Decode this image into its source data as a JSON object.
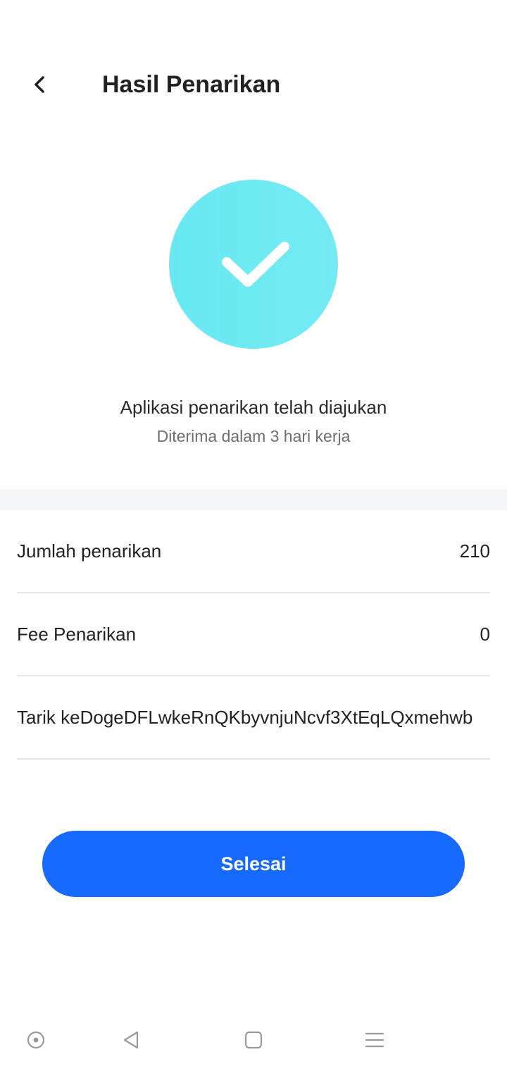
{
  "header": {
    "title": "Hasil Penarikan",
    "back_icon": "chevron-left-icon"
  },
  "status": {
    "icon": "checkmark-icon",
    "accent_color": "#6aebf2",
    "message": "Aplikasi penarikan telah diajukan",
    "submessage": "Diterima dalam 3 hari kerja"
  },
  "details": [
    {
      "label": "Jumlah penarikan",
      "value": "210"
    },
    {
      "label": "Fee Penarikan",
      "value": "0"
    },
    {
      "label": "Tarik keDogeDFLwkeRnQKbyvnjuNcvf3XtEqLQxmehwb",
      "value": ""
    }
  ],
  "actions": {
    "done_label": "Selesai",
    "button_color": "#166aff"
  },
  "system_nav": {
    "items": [
      "assistant-icon",
      "back-triangle-icon",
      "home-square-icon",
      "menu-lines-icon"
    ]
  }
}
